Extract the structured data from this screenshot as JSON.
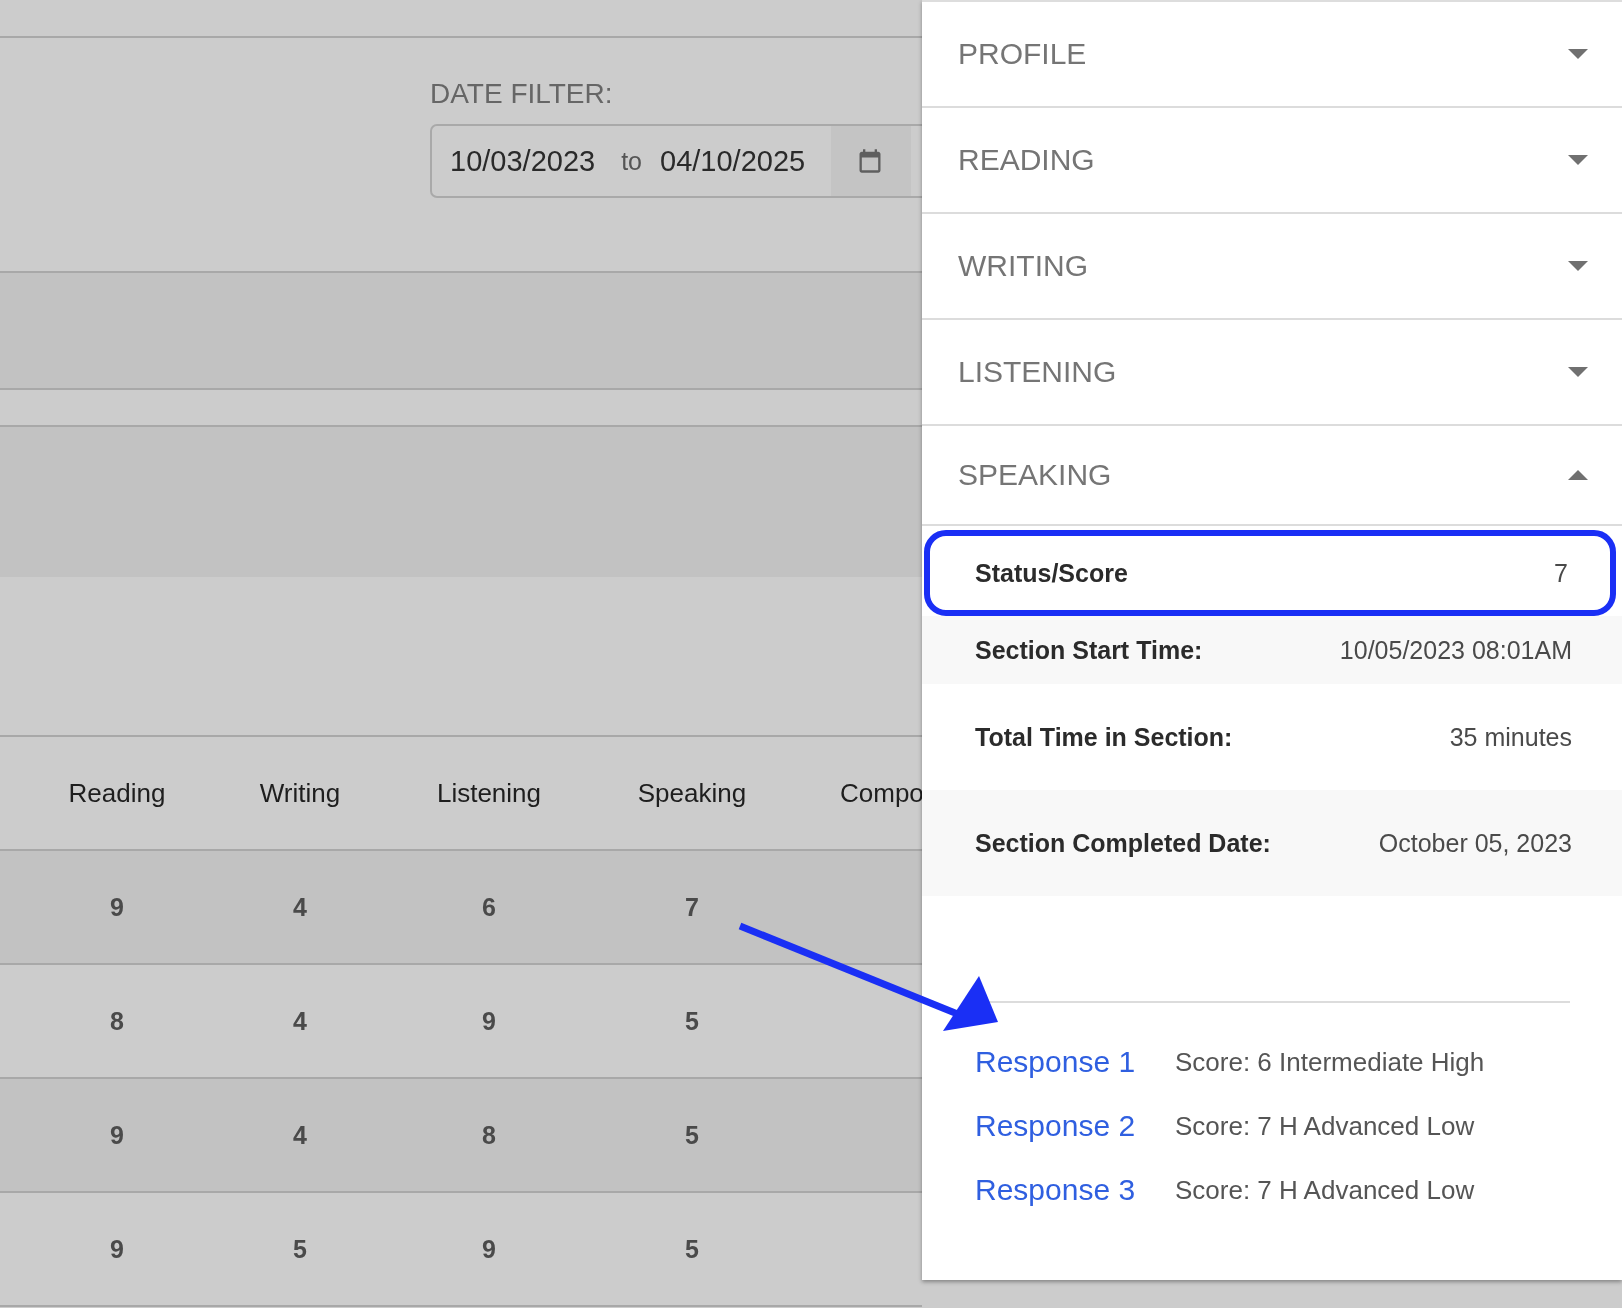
{
  "date_filter": {
    "label": "DATE FILTER:",
    "start": "10/03/2023",
    "separator": "to",
    "end": "04/10/2025"
  },
  "table": {
    "columns": [
      "Reading",
      "Writing",
      "Listening",
      "Speaking",
      "Compo"
    ],
    "rows": [
      [
        "9",
        "4",
        "6",
        "7"
      ],
      [
        "8",
        "4",
        "9",
        "5"
      ],
      [
        "9",
        "4",
        "8",
        "5"
      ],
      [
        "9",
        "5",
        "9",
        "5"
      ]
    ]
  },
  "panel": {
    "sections": [
      {
        "title": "PROFILE",
        "expanded": false
      },
      {
        "title": "READING",
        "expanded": false
      },
      {
        "title": "WRITING",
        "expanded": false
      },
      {
        "title": "LISTENING",
        "expanded": false
      },
      {
        "title": "SPEAKING",
        "expanded": true
      }
    ],
    "details": [
      {
        "label": "Status/Score",
        "value": "7",
        "highlighted": true
      },
      {
        "label": "Section Start Time:",
        "value": "10/05/2023 08:01AM",
        "highlighted": false
      },
      {
        "label": "Total Time in Section:",
        "value": "35 minutes",
        "highlighted": false
      },
      {
        "label": "Section Completed Date:",
        "value": "October 05, 2023",
        "highlighted": false
      }
    ],
    "responses": [
      {
        "link": "Response 1",
        "score": "Score: 6 Intermediate High"
      },
      {
        "link": "Response 2",
        "score": "Score: 7 H Advanced Low"
      },
      {
        "link": "Response 3",
        "score": "Score: 7 H Advanced Low"
      }
    ]
  }
}
